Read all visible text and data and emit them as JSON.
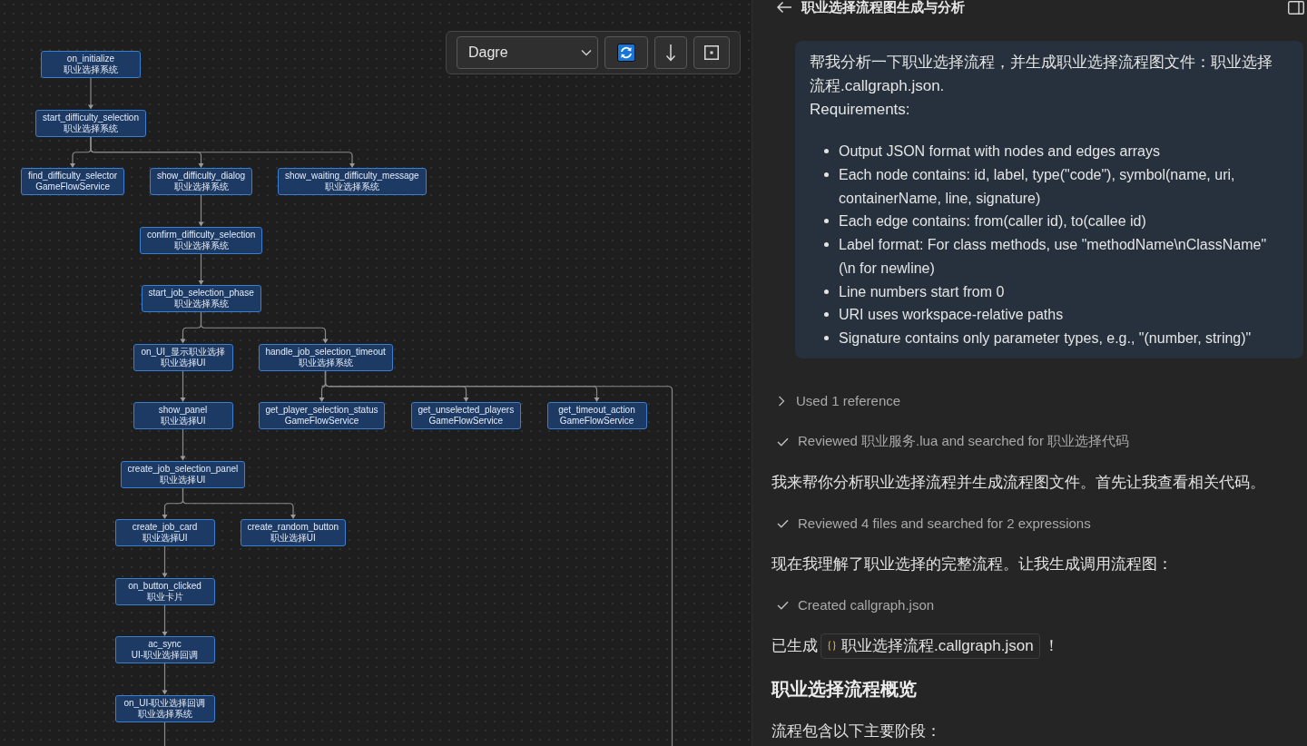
{
  "graph": {
    "nodes": [
      {
        "name": "on_initialize",
        "owner": "职业选择系统",
        "continues": false,
        "children": [
          {
            "name": "start_difficulty_selection",
            "owner": "职业选择系统",
            "continues": false,
            "children": [
              {
                "name": "find_difficulty_selector",
                "owner": "GameFlowService",
                "continues": false
              },
              {
                "name": "show_difficulty_dialog",
                "owner": "职业选择系统",
                "continues": false,
                "children": [
                  {
                    "name": "confirm_difficulty_selection",
                    "owner": "职业选择系统",
                    "continues": false,
                    "children": [
                      {
                        "name": "start_job_selection_phase",
                        "owner": "职业选择系统",
                        "continues": false,
                        "children": [
                          {
                            "name": "on_UI_显示职业选择",
                            "owner": "职业选择UI",
                            "continues": false,
                            "children": [
                              {
                                "name": "show_panel",
                                "owner": "职业选择UI",
                                "continues": false,
                                "children": [
                                  {
                                    "name": "create_job_selection_panel",
                                    "owner": "职业选择UI",
                                    "continues": false,
                                    "children": [
                                      {
                                        "name": "create_job_card",
                                        "owner": "职业选择UI",
                                        "continues": false,
                                        "children": [
                                          {
                                            "name": "on_button_clicked",
                                            "owner": "职业卡片",
                                            "continues": false,
                                            "children": [
                                              {
                                                "name": "ac_sync",
                                                "owner": "UI-职业选择回调",
                                                "continues": false,
                                                "children": [
                                                  {
                                                    "name": "on_UI-职业选择回调",
                                                    "owner": "职业选择系统",
                                                    "continues": true
                                                  }
                                                ]
                                              }
                                            ]
                                          }
                                        ]
                                      },
                                      {
                                        "name": "create_random_button",
                                        "owner": "职业选择UI",
                                        "continues": false
                                      }
                                    ]
                                  }
                                ]
                              }
                            ]
                          },
                          {
                            "name": "handle_job_selection_timeout",
                            "owner": "职业选择系统",
                            "continues": true,
                            "children": [
                              {
                                "name": "get_player_selection_status",
                                "owner": "GameFlowService",
                                "continues": false
                              },
                              {
                                "name": "get_unselected_players",
                                "owner": "GameFlowService",
                                "continues": false
                              },
                              {
                                "name": "get_timeout_action",
                                "owner": "GameFlowService",
                                "continues": false
                              }
                            ]
                          }
                        ]
                      }
                    ]
                  }
                ]
              },
              {
                "name": "show_waiting_difficulty_message",
                "owner": "职业选择系统",
                "continues": false
              }
            ]
          }
        ]
      }
    ]
  },
  "toolbar": {
    "layout": "Dagre",
    "buttons": [
      {
        "kind": "refresh"
      },
      {
        "kind": "down_arrow"
      },
      {
        "kind": "fit"
      }
    ]
  },
  "chat": {
    "title": "职业选择流程图生成与分析",
    "request": {
      "intro": "帮我分析一下职业选择流程，并生成职业选择流程图文件：职业选择流程.callgraph.json.",
      "label": "Requirements:",
      "items": [
        "Output JSON format with nodes and edges arrays",
        "Each node contains: id, label, type(\"code\"), symbol(name, uri, containerName, line, signature)",
        "Each edge contains: from(caller id), to(callee id)",
        "Label format: For class methods, use \"methodName\\nClassName\" (\\n for newline)",
        "Line numbers start from 0",
        "URI uses workspace-relative paths",
        "Signature contains only parameter types, e.g., \"(number, string)\""
      ]
    },
    "entries": [
      {
        "kind": "reference",
        "text": "Used 1 reference",
        "expanded": false
      },
      {
        "kind": "step",
        "text": "Reviewed 职业服务.lua and searched for 职业选择代码",
        "done": true
      },
      {
        "kind": "text",
        "text": "我来帮你分析职业选择流程并生成流程图文件。首先让我查看相关代码。"
      },
      {
        "kind": "step",
        "text": "Reviewed 4 files and searched for 2 expressions",
        "done": true
      },
      {
        "kind": "text",
        "text": "现在我理解了职业选择的完整流程。让我生成调用流程图："
      },
      {
        "kind": "step",
        "text": "Created callgraph.json",
        "done": true
      },
      {
        "kind": "file_message",
        "before": "已生成",
        "file": "职业选择流程.callgraph.json",
        "after": "！"
      },
      {
        "kind": "heading",
        "text": "职业选择流程概览"
      },
      {
        "kind": "text",
        "text": "流程包含以下主要阶段："
      }
    ]
  }
}
